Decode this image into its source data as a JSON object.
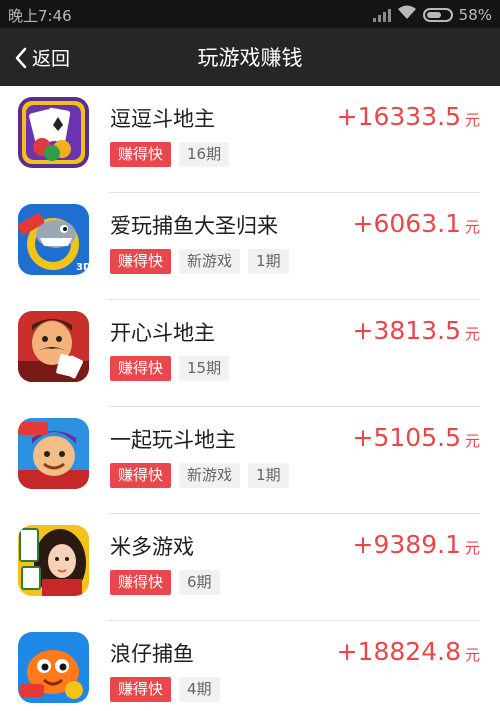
{
  "status_bar": {
    "time": "晚上7:46",
    "battery": "58%"
  },
  "nav": {
    "back_label": "返回",
    "title": "玩游戏赚钱"
  },
  "colors": {
    "accent": "#e9474b",
    "nav_bg": "#262626",
    "status_bg": "#141414"
  },
  "games": [
    {
      "name": "逗逗斗地主",
      "tags": [
        "赚得快",
        "16期"
      ],
      "amount": "+16333.5",
      "unit": "元",
      "icon": "poker-cards-icon"
    },
    {
      "name": "爱玩捕鱼大圣归来",
      "tags": [
        "赚得快",
        "新游戏",
        "1期"
      ],
      "amount": "+6063.1",
      "unit": "元",
      "icon": "shark-fishing-icon",
      "icon_badges": [
        "送红包",
        "3D"
      ]
    },
    {
      "name": "开心斗地主",
      "tags": [
        "赚得快",
        "15期"
      ],
      "amount": "+3813.5",
      "unit": "元",
      "icon": "mustache-man-icon"
    },
    {
      "name": "一起玩斗地主",
      "tags": [
        "赚得快",
        "新游戏",
        "1期"
      ],
      "amount": "+5105.5",
      "unit": "元",
      "icon": "cartoon-landlord-icon",
      "icon_badges": [
        "送红包"
      ]
    },
    {
      "name": "米多游戏",
      "tags": [
        "赚得快",
        "6期"
      ],
      "amount": "+9389.1",
      "unit": "元",
      "icon": "mahjong-girl-icon",
      "icon_badges": [
        "米围"
      ]
    },
    {
      "name": "浪仔捕鱼",
      "tags": [
        "赚得快",
        "4期"
      ],
      "amount": "+18824.8",
      "unit": "元",
      "icon": "orange-fish-icon",
      "icon_badges": [
        "红包"
      ]
    }
  ]
}
